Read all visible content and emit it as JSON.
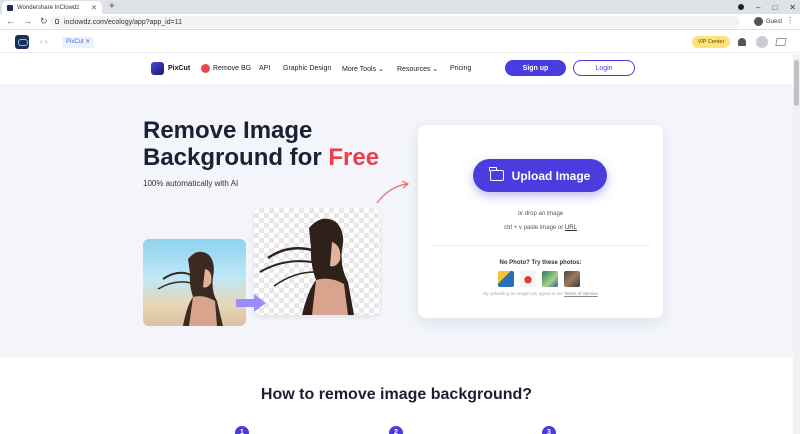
{
  "browser": {
    "tab_title": "Wondershare InClowdz",
    "new_tab": "+",
    "url": "inclowdz.com/ecology/app?app_id=11",
    "guest_label": "Guest"
  },
  "appbar": {
    "tab_label": "PixCut",
    "vip_label": "VIP Center"
  },
  "header": {
    "brand": "PixCut",
    "remove_bg": "Remove BG",
    "nav": [
      "API",
      "Graphic Design",
      "More Tools",
      "Resources",
      "Pricing"
    ],
    "signup": "Sign up",
    "login": "Login"
  },
  "hero": {
    "title_line1": "Remove Image",
    "title_line2": "Background for ",
    "title_free": "Free",
    "subtitle": "100% automatically with AI"
  },
  "upload_card": {
    "button": "Upload Image",
    "or_drop": "or drop an image",
    "paste_prefix": "ctrl + v paste image or ",
    "paste_link": "URL",
    "no_photo": "No Photo? Try these photos:",
    "terms_prefix": "By uploading an image you agree to our ",
    "terms_link": "Terms of Service"
  },
  "section2": {
    "title": "How to remove image background?",
    "steps": [
      "1",
      "2",
      "3"
    ]
  },
  "colors": {
    "brand_purple": "#4b3ce0",
    "free_red": "#e83f4a",
    "vip_yellow": "#ffe27a"
  }
}
